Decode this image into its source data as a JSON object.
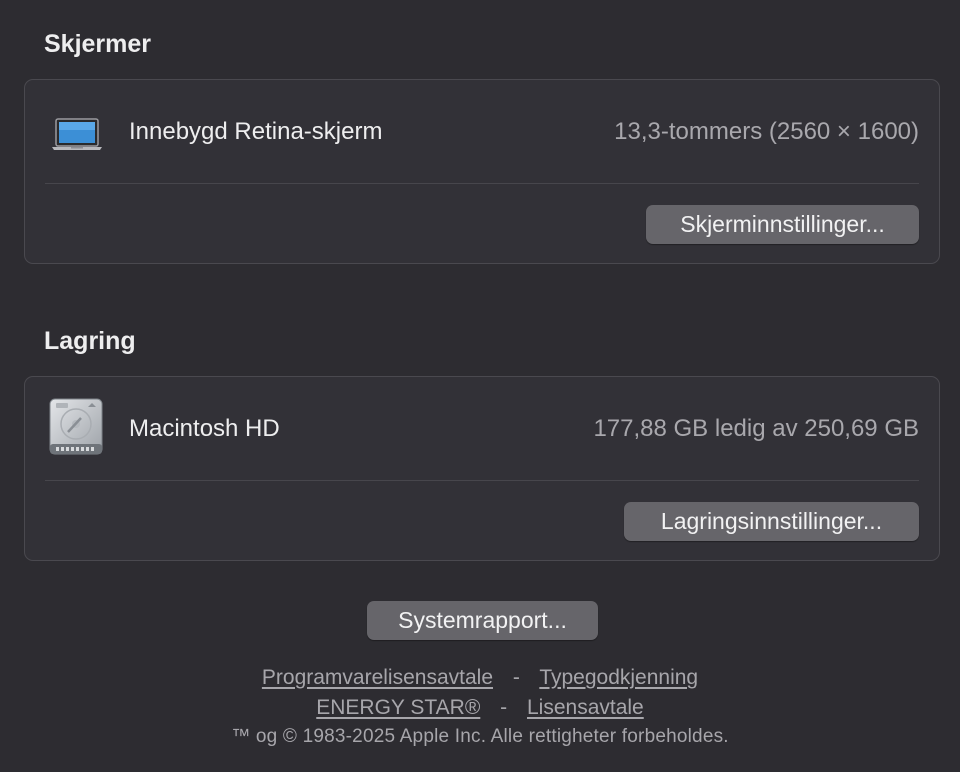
{
  "displays": {
    "title": "Skjermer",
    "item": {
      "icon": "laptop-icon",
      "name": "Innebygd Retina-skjerm",
      "value": "13,3-tommers (2560 × 1600)"
    },
    "button_label": "Skjerminnstillinger..."
  },
  "storage": {
    "title": "Lagring",
    "item": {
      "icon": "hard-drive-icon",
      "name": "Macintosh HD",
      "value": "177,88 GB ledig av 250,69 GB"
    },
    "button_label": "Lagringsinnstillinger..."
  },
  "system_report_label": "Systemrapport...",
  "footer": {
    "links_row1": [
      "Programvarelisensavtale",
      "Typegodkjenning"
    ],
    "links_row2": [
      "ENERGY STAR®",
      "Lisensavtale"
    ],
    "separator": "-",
    "copyright": "™ og © 1983-2025 Apple Inc. Alle rettigheter forbeholdes."
  },
  "colors": {
    "background": "#2d2c31",
    "card": "#323137",
    "button": "#66656a",
    "secondary_text": "#a9a8ad"
  }
}
